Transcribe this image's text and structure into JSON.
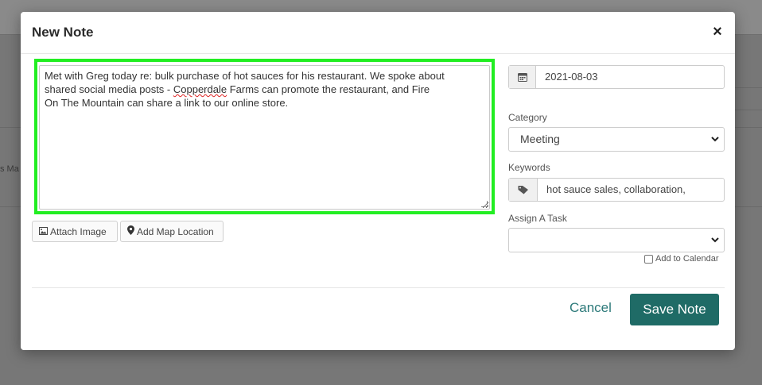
{
  "background": {
    "partial_text": "s Ma"
  },
  "modal": {
    "title": "New Note",
    "close_symbol": "×",
    "note": {
      "line1": "Met with Greg today re: bulk purchase of hot sauces for his restaurant. We spoke about",
      "line2a": "shared social media posts - ",
      "line2_misspelled": "Copperdale",
      "line2b": " Farms can promote the restaurant, and Fire",
      "line3": "On The Mountain can share a link to our online store."
    },
    "attach_image_label": "Attach Image",
    "add_map_location_label": "Add Map Location",
    "date_value": "2021-08-03",
    "category": {
      "label": "Category",
      "selected": "Meeting"
    },
    "keywords": {
      "label": "Keywords",
      "value": "hot sauce sales, collaboration,"
    },
    "assign_task": {
      "label": "Assign A Task",
      "selected": ""
    },
    "add_to_calendar_label": "Add to Calendar",
    "cancel_label": "Cancel",
    "save_label": "Save Note"
  },
  "colors": {
    "accent": "#1f6b66",
    "link": "#2d7a7a",
    "highlight": "#22ee22"
  },
  "icons": [
    "calendar-icon",
    "tag-icon",
    "image-icon",
    "map-marker-icon",
    "chevron-down-icon",
    "close-icon"
  ]
}
